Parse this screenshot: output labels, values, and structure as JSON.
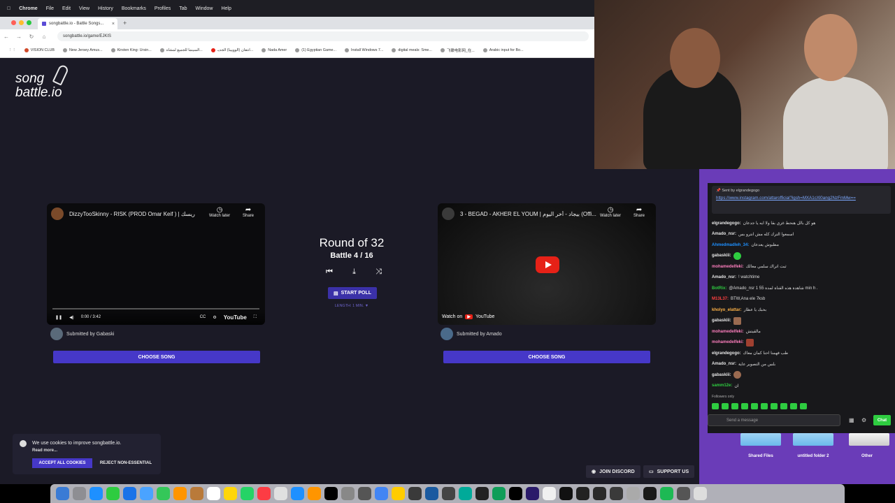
{
  "menubar": {
    "items": [
      "Chrome",
      "File",
      "Edit",
      "View",
      "History",
      "Bookmarks",
      "Profiles",
      "Tab",
      "Window",
      "Help"
    ]
  },
  "browser": {
    "tab_title": "songbattle.io - Battle Songs...",
    "url": "songbattle.io/game/EJKIS",
    "bookmarks": [
      "VISION CLUB",
      "New Jersey Amus...",
      "Kirsten King: Ursin...",
      "السينما للجميع لمشاه...",
      "انتقان (الووييبا) الجديـ...",
      "Nada Amer",
      "(1) Egyptian Game...",
      "Install Windows 7...",
      "digital meals: Sme...",
      "飞碟电影网_在...",
      "Arabic input for Bo..."
    ]
  },
  "logo": {
    "line1": "song",
    "line2": "battle.io"
  },
  "left_song": {
    "title": "DizzyTooSkinny - RISK (PROD Omar Keif ) | ريسك",
    "watch_later": "Watch later",
    "share": "Share",
    "time": "0:00 / 3:42",
    "youtube": "YouTube",
    "submitted_by": "Submitted by Gabaski",
    "choose": "CHOOSE SONG"
  },
  "right_song": {
    "title": "3 - BEGAD - AKHER EL YOUM | بيجاد - أخر اليوم (Offi...",
    "watch_later": "Watch later",
    "share": "Share",
    "watch_on": "Watch on",
    "youtube": "YouTube",
    "submitted_by": "Submitted by Amado",
    "choose": "CHOOSE SONG"
  },
  "battle": {
    "round": "Round of 32",
    "battle": "Battle 4 / 16",
    "start_poll": "START POLL",
    "length": "LENGTH: 1 MIN. ▼"
  },
  "cookie": {
    "text": "We use cookies to improve songbattle.io.",
    "read_more": "Read more...",
    "accept": "ACCEPT ALL COOKIES",
    "reject": "REJECT NON-ESSENTIAL"
  },
  "footer": {
    "discord": "JOIN DISCORD",
    "support": "SUPPORT US"
  },
  "chat": {
    "pinned_by": "Sent by elgrandegogo",
    "pinned_link": "https://www.instagram.com/attarofficial?igsh=MXA1cXl0ang2NzFmMw==",
    "messages": [
      {
        "user": "elgrandegogo:",
        "text": "هو كل بالل هنحط غزي بقا ولا ايه يا جدعان",
        "color": "#e6e6e6"
      },
      {
        "user": "Amado_nsr:",
        "text": "اسمعوا الترك كله مش انترو بس",
        "color": "#e6e6e6"
      },
      {
        "user": "Ahmedmadleh_34:",
        "text": "مظبوش يعدعان",
        "color": "#1e90ff"
      },
      {
        "user": "gabaskiii:",
        "text": "",
        "color": "#e6e6e6"
      },
      {
        "user": "mohamedelfeki:",
        "text": "ثبت اتراك سلمي معالك",
        "color": "#ff7fbf"
      },
      {
        "user": "Amado_nsr:",
        "text": "! watchtime",
        "color": "#e6e6e6"
      },
      {
        "user": "BotRix:",
        "text": "@Amado_nsr 1 شاهدة هذه القناة لمدة 55 min h .",
        "color": "#2ecc40"
      },
      {
        "user": "M13L37:",
        "text": "BTW,Ana ele 7ksb",
        "color": "#ff4040"
      },
      {
        "user": "kholyo_elattar:",
        "text": "بحبك يا عطار",
        "color": "#ffb347"
      },
      {
        "user": "gabaskiii:",
        "text": "",
        "color": "#e6e6e6"
      },
      {
        "user": "mohamedelfeki:",
        "text": "مالقيتش",
        "color": "#ff7fbf"
      },
      {
        "user": "mohamedelfeki:",
        "text": "",
        "color": "#ff7fbf"
      },
      {
        "user": "elgrandegogo:",
        "text": "طب فهمنا احنا كمان معاك",
        "color": "#e6e6e6"
      },
      {
        "user": "Amado_nsr:",
        "text": "بلس من التصوير عاية",
        "color": "#e6e6e6"
      },
      {
        "user": "gabaskiii:",
        "text": "",
        "color": "#e6e6e6"
      },
      {
        "user": "samm12e:",
        "text": "ان",
        "color": "#2ecc40"
      }
    ],
    "followers_only": "Followers only",
    "placeholder": "Send a message",
    "chat_button": "Chat"
  },
  "desktop": {
    "folders": [
      "Shared Files",
      "untitled folder 2",
      "Other"
    ]
  }
}
